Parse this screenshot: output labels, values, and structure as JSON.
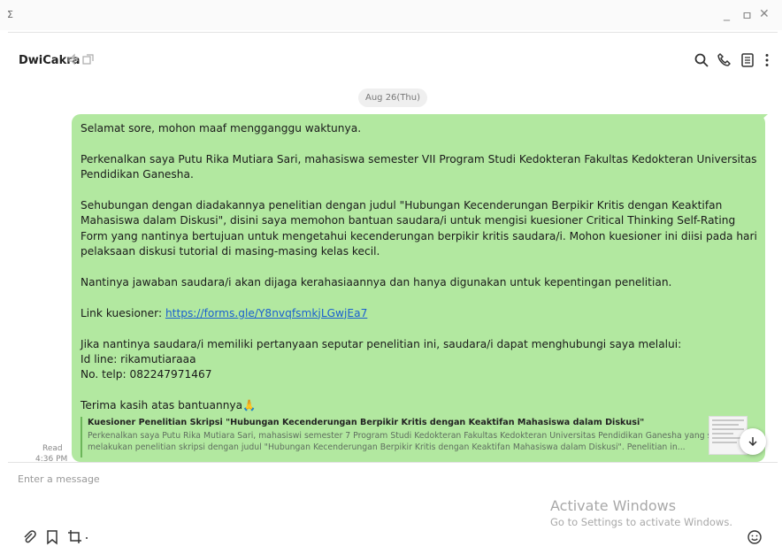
{
  "window": {
    "app_glyph": "ⵉ",
    "minimize": "_",
    "maximize": "ㅁ",
    "close": "✕"
  },
  "header": {
    "chat_name": "DwiCakra",
    "icons": [
      "notification-off-icon",
      "popout-icon",
      "search-icon",
      "phone-icon",
      "drawer-icon",
      "more-icon"
    ]
  },
  "conversation": {
    "date_divider": "Aug 26(Thu)",
    "message": {
      "line1": "Selamat sore, mohon maaf mengganggu waktunya.",
      "line2": "Perkenalkan saya Putu Rika Mutiara Sari, mahasiswa semester VII Program Studi Kedokteran Fakultas Kedokteran Universitas Pendidikan Ganesha.",
      "line3": "Sehubungan dengan diadakannya penelitian dengan judul \"Hubungan Kecenderungan Berpikir Kritis dengan Keaktifan Mahasiswa dalam Diskusi\", disini saya memohon bantuan saudara/i untuk mengisi kuesioner Critical Thinking Self-Rating Form yang nantinya bertujuan untuk mengetahui kecenderungan berpikir kritis saudara/i. Mohon kuesioner ini diisi pada hari pelaksaan diskusi tutorial di masing-masing kelas kecil.",
      "line4": "Nantinya jawaban saudara/i akan dijaga kerahasiaannya dan hanya digunakan untuk kepentingan penelitian.",
      "link_prefix": "Link kuesioner: ",
      "link_text": "https://forms.gle/Y8nvqfsmkjLGwjEa7",
      "contact_intro": "Jika nantinya saudara/i memiliki pertanyaan seputar penelitian ini, saudara/i dapat menghubungi saya melalui:",
      "contact_line": "Id line: rikamutiaraaa",
      "contact_phone": "No. telp: 082247971467",
      "closing": "Terima kasih atas bantuannya",
      "closing_emoji": "🙏"
    },
    "link_preview": {
      "title": "Kuesioner Penelitian Skripsi \"Hubungan Kecenderungan Berpikir Kritis dengan Keaktifan Mahasiswa dalam Diskusi\"",
      "description": "Perkenalkan saya Putu Rika Mutiara Sari, mahasiswi semester 7 Program Studi Kedokteran Fakultas Kedokteran Universitas Pendidikan Ganesha yang sedang melakukan penelitian skripsi dengan judul \"Hubungan Kecenderungan Berpikir Kritis dengan Keaktifan Mahasiswa dalam Diskusi\". Penelitian in..."
    },
    "status": {
      "read": "Read",
      "time": "4:36 PM"
    }
  },
  "composer": {
    "placeholder": "Enter a message",
    "icons": [
      "attach-icon",
      "bookmark-icon",
      "screenshot-icon",
      "emoji-icon"
    ]
  },
  "watermark": {
    "title": "Activate Windows",
    "subtitle": "Go to Settings to activate Windows."
  },
  "colors": {
    "bubble": "#b2e8a0",
    "link": "#1a5fd0",
    "preview_border": "#6cb65a"
  }
}
